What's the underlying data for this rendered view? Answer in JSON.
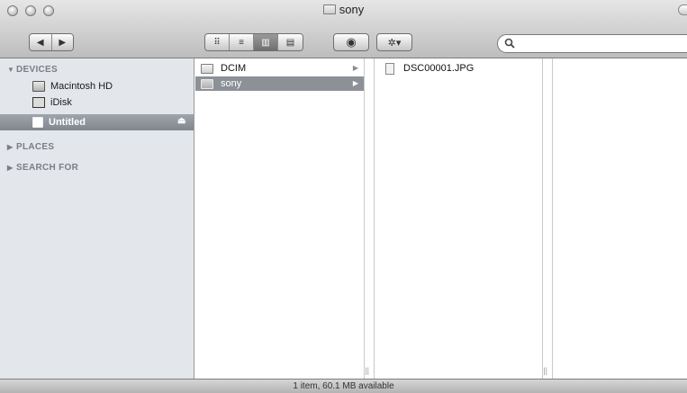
{
  "window": {
    "title": "sony"
  },
  "toolbar": {
    "back_glyph": "◀",
    "forward_glyph": "▶",
    "view_icon_glyph": "⠿",
    "view_list_glyph": "≡",
    "view_column_glyph": "▥",
    "view_coverflow_glyph": "▤",
    "quicklook_glyph": "◉",
    "action_glyph": "✲▾",
    "active_view": "column",
    "search": {
      "value": "",
      "placeholder": ""
    }
  },
  "sidebar": {
    "sections": [
      {
        "label": "DEVICES",
        "expanded": true
      },
      {
        "label": "PLACES",
        "expanded": false
      },
      {
        "label": "SEARCH FOR",
        "expanded": false
      }
    ],
    "devices": [
      {
        "label": "Macintosh HD",
        "icon": "hard-drive-icon",
        "selected": false
      },
      {
        "label": "iDisk",
        "icon": "idisk-icon",
        "selected": false
      },
      {
        "label": "Untitled",
        "icon": "volume-icon",
        "selected": true,
        "ejectable": true
      }
    ],
    "eject_glyph": "⏏"
  },
  "columns": [
    {
      "items": [
        {
          "name": "DCIM",
          "kind": "folder",
          "selected": false,
          "has_children": true
        },
        {
          "name": "sony",
          "kind": "folder",
          "selected": true,
          "has_children": true
        }
      ]
    },
    {
      "items": [
        {
          "name": "DSC00001.JPG",
          "kind": "jpeg-file",
          "selected": false,
          "has_children": false
        }
      ]
    },
    {
      "items": []
    }
  ],
  "status_bar": {
    "text": "1 item, 60.1 MB available"
  },
  "colors": {
    "sidebar_bg": "#e3e6ea",
    "selection_gray": "#8c9198",
    "sidebar_selection": "#7f868e"
  }
}
